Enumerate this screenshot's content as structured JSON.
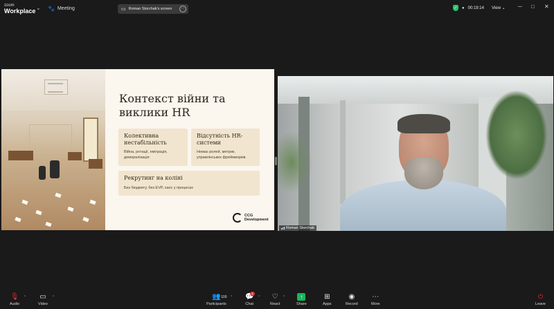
{
  "app": {
    "brand_small": "zoom",
    "brand_big": "Workplace",
    "meeting_label": "Meeting"
  },
  "share_pill": {
    "text": "Roman Storchak's screen"
  },
  "status": {
    "timer": "00:19:14",
    "view_label": "View"
  },
  "slide": {
    "title": "Контекст війни та виклики HR",
    "cards": [
      {
        "title": "Колективна нестабільність",
        "subtitle": "Війна, ротації, еміграція, деморалізація"
      },
      {
        "title": "Відсутність HR-системи",
        "subtitle": "Немає ролей, метрик, управлінських фреймворків"
      },
      {
        "title": "Рекрутинг на коліні",
        "subtitle": "Без бюджету, без EVP, хаос у процесах"
      }
    ],
    "logo_line1": "CCG",
    "logo_line2": "Development"
  },
  "video": {
    "participant_name": "Roman Storchak"
  },
  "toolbar": {
    "audio": "Audio",
    "video": "Video",
    "participants": "Participants",
    "participants_count": "100",
    "chat": "Chat",
    "chat_badge": "1",
    "react": "React",
    "share": "Share",
    "apps": "Apps",
    "record": "Record",
    "more": "More",
    "leave": "Leave"
  },
  "colors": {
    "share_green": "#19b45c",
    "leave_red": "#e0333a",
    "secure_green": "#27c26c",
    "slide_bg": "#fbf6ee",
    "card_bg": "#f1e5cf"
  }
}
